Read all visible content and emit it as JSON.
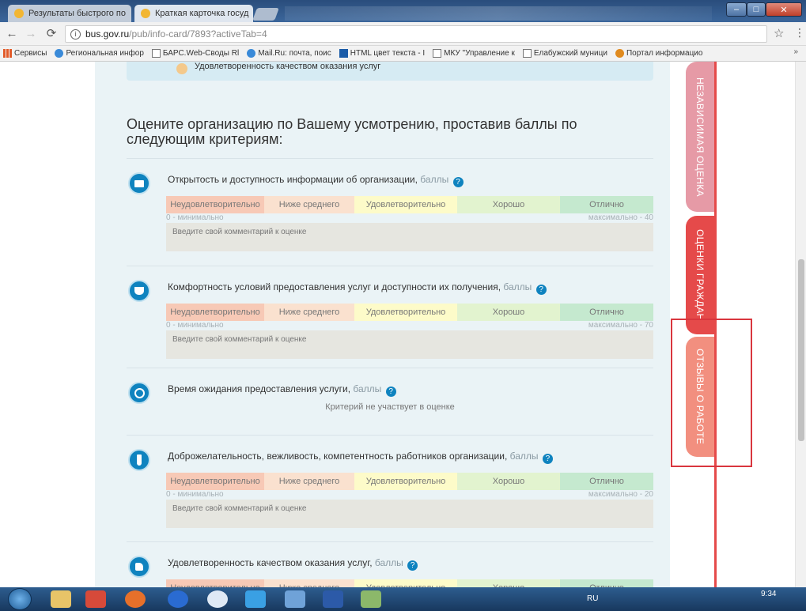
{
  "browser": {
    "tabs": [
      {
        "label": "Результаты быстрого по"
      },
      {
        "label": "Краткая карточка госуд"
      }
    ],
    "url_host": "bus.gov.ru",
    "url_path": "/pub/info-card/7893?activeTab=4",
    "bookmarks": [
      {
        "label": "Сервисы",
        "icon": "apps-grid-icon"
      },
      {
        "label": "Региональная инфор",
        "icon": "globe-icon"
      },
      {
        "label": "БАРС.Web-Своды Rl",
        "icon": "page-icon"
      },
      {
        "label": "Mail.Ru: почта, поис",
        "icon": "mail-icon"
      },
      {
        "label": "HTML цвет текста - I",
        "icon": "html-icon"
      },
      {
        "label": "МКУ \"Управление к",
        "icon": "page-icon"
      },
      {
        "label": "Елабужский муници",
        "icon": "page-icon"
      },
      {
        "label": "Портал информацио",
        "icon": "portal-icon"
      }
    ],
    "bookmarks_more": "»"
  },
  "page": {
    "top_item": "Удовлетворенность качеством оказания услуг",
    "heading": "Оцените организацию по Вашему усмотрению, проставив баллы по следующим критериям:",
    "unit_label": "баллы",
    "scale_labels": [
      "Неудовлетворительно",
      "Ниже среднего",
      "Удовлетворительно",
      "Хорошо",
      "Отлично"
    ],
    "min_label": "0 - минимально",
    "comment_placeholder": "Введите свой комментарий к оценке",
    "criteria": [
      {
        "title": "Открытость и доступность информации об организации,",
        "max_label": "максимально - 40",
        "icon": "monitor-icon"
      },
      {
        "title": "Комфортность условий предоставления услуг и доступности их получения,",
        "max_label": "максимально - 70",
        "icon": "cup-icon"
      },
      {
        "title": "Время ожидания предоставления услуги,",
        "note": "Критерий не участвует в оценке",
        "icon": "clock-icon"
      },
      {
        "title": "Доброжелательность, вежливость, компетентность работников организации,",
        "max_label": "максимально - 20",
        "icon": "tie-icon"
      },
      {
        "title": "Удовлетворенность качеством оказания услуг,",
        "icon": "thumbs-up-icon"
      }
    ]
  },
  "side_tabs": [
    {
      "label": "НЕЗАВИСИМАЯ ОЦЕНКА"
    },
    {
      "label": "ОЦЕНКИ ГРАЖДАН"
    },
    {
      "label": "ОТЗЫВЫ О РАБОТЕ"
    }
  ],
  "taskbar": {
    "lang": "RU",
    "time": "9:34"
  }
}
